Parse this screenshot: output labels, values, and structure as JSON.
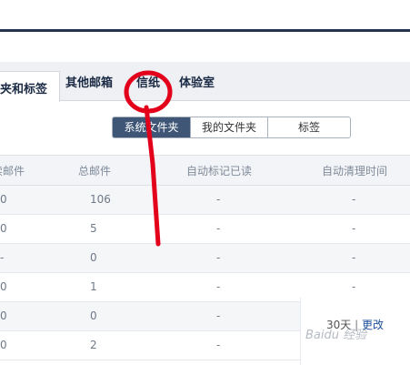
{
  "tabs": {
    "active_label": "夹和标签",
    "other_mail": "其他邮箱",
    "letter_paper": "信纸",
    "lab": "体验室"
  },
  "segmented": {
    "system_folders": "系统文件夹",
    "my_folders": "我的文件夹",
    "tags": "标签"
  },
  "table": {
    "headers": [
      "未读邮件",
      "总邮件",
      "自动标记已读",
      "自动清理时间"
    ],
    "header_unread_visible": "读邮件",
    "rows": [
      {
        "unread": "0",
        "total": "106",
        "auto_read": "-",
        "auto_clean": "-"
      },
      {
        "unread": "0",
        "total": "5",
        "auto_read": "-",
        "auto_clean": "-"
      },
      {
        "unread": "-",
        "total": "0",
        "auto_read": "-",
        "auto_clean": "-"
      },
      {
        "unread": "0",
        "total": "1",
        "auto_read": "-",
        "auto_clean": "-"
      },
      {
        "unread": "0",
        "total": "0",
        "auto_read": "-",
        "auto_clean": ""
      },
      {
        "unread": "0",
        "total": "2",
        "auto_read": "-",
        "auto_clean": ""
      }
    ]
  },
  "action": {
    "days": "30天",
    "separator": "|",
    "change": "更改"
  },
  "watermark": "Baidu 经验",
  "colors": {
    "dark_bar": "#26344f",
    "active_segment": "#3f5677",
    "annotation_red": "#e3001b",
    "link": "#1b4f9c"
  }
}
